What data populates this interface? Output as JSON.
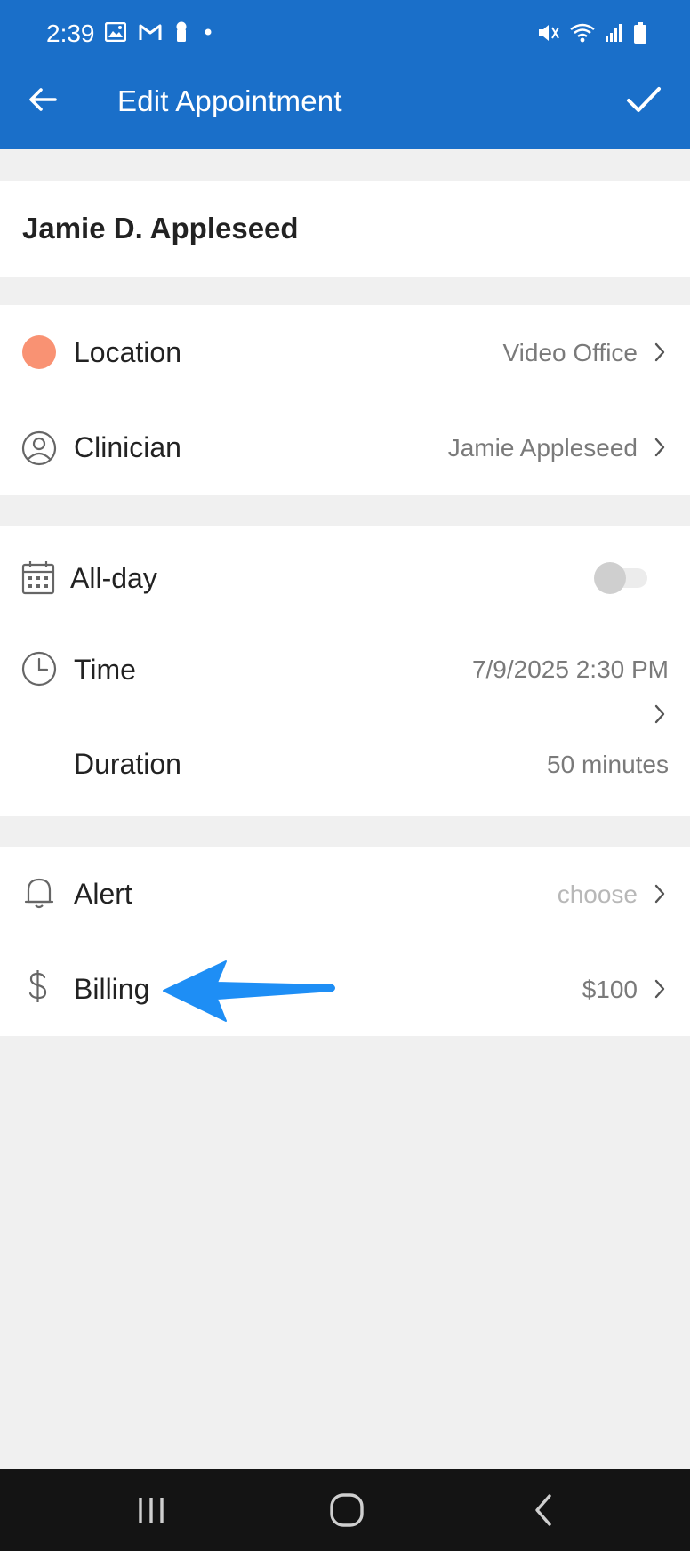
{
  "status_bar": {
    "time": "2:39",
    "left_icons": [
      "image-icon",
      "gmail-icon",
      "keyhole-icon",
      "dot-icon"
    ],
    "right_icons": [
      "mute-icon",
      "wifi-icon",
      "signal-icon",
      "battery-icon"
    ]
  },
  "toolbar": {
    "title": "Edit Appointment",
    "back_icon": "arrow-left-icon",
    "save_icon": "check-icon"
  },
  "client": {
    "name": "Jamie D. Appleseed"
  },
  "details": {
    "location": {
      "label": "Location",
      "value": "Video Office",
      "dot_color": "#f99273"
    },
    "clinician": {
      "label": "Clinician",
      "value": "Jamie Appleseed"
    }
  },
  "schedule": {
    "all_day": {
      "label": "All-day",
      "enabled": false
    },
    "time": {
      "label": "Time",
      "value": "7/9/2025 2:30 PM"
    },
    "duration": {
      "label": "Duration",
      "value": "50 minutes"
    }
  },
  "extras": {
    "alert": {
      "label": "Alert",
      "value": "choose"
    },
    "billing": {
      "label": "Billing",
      "value": "$100"
    }
  },
  "colors": {
    "app_bar": "#1a6fc9",
    "annotation_arrow": "#1e8ef5",
    "background": "#f0f0f0"
  },
  "nav_bar": [
    "recents-icon",
    "home-icon",
    "back-icon"
  ]
}
